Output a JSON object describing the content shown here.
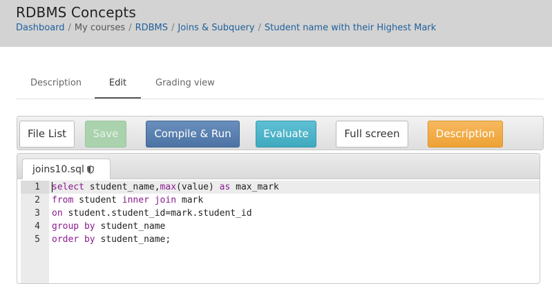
{
  "header": {
    "title": "RDBMS Concepts",
    "breadcrumb": [
      "Dashboard",
      "My courses",
      "RDBMS",
      "Joins & Subquery",
      "Student name with their Highest Mark"
    ],
    "separator": "/",
    "background": "#d3d3d3",
    "link_color": "#1f5f9a"
  },
  "tabs": [
    "Description",
    "Edit",
    "Grading view"
  ],
  "active_tab": "Edit",
  "toolbar": {
    "file_list": "File List",
    "save": "Save",
    "compile_run": "Compile & Run",
    "evaluate": "Evaluate",
    "full_screen": "Full screen",
    "description": "Description",
    "colors": {
      "save": "#a9d2ad",
      "compile_run": "#4b73a3",
      "evaluate": "#3fa9bf",
      "description": "#eea236"
    }
  },
  "editor": {
    "file_tab": "joins10.sql",
    "file_tab_icon": "shield-icon",
    "keyword_color": "#8a1a8f",
    "lines": [
      {
        "num": "1",
        "tokens": [
          {
            "text": "select",
            "kw": true
          },
          {
            "text": " student_name,",
            "kw": false
          },
          {
            "text": "max",
            "kw": true
          },
          {
            "text": "(value) ",
            "kw": false
          },
          {
            "text": "as",
            "kw": true
          },
          {
            "text": " max_mark",
            "kw": false
          }
        ]
      },
      {
        "num": "2",
        "tokens": [
          {
            "text": "from",
            "kw": true
          },
          {
            "text": " student ",
            "kw": false
          },
          {
            "text": "inner join",
            "kw": true
          },
          {
            "text": " mark",
            "kw": false
          }
        ]
      },
      {
        "num": "3",
        "tokens": [
          {
            "text": "on",
            "kw": true
          },
          {
            "text": " student.student_id=mark.student_id",
            "kw": false
          }
        ]
      },
      {
        "num": "4",
        "tokens": [
          {
            "text": "group by",
            "kw": true
          },
          {
            "text": " student_name",
            "kw": false
          }
        ]
      },
      {
        "num": "5",
        "tokens": [
          {
            "text": "order by",
            "kw": true
          },
          {
            "text": " student_name;",
            "kw": false
          }
        ]
      }
    ]
  }
}
